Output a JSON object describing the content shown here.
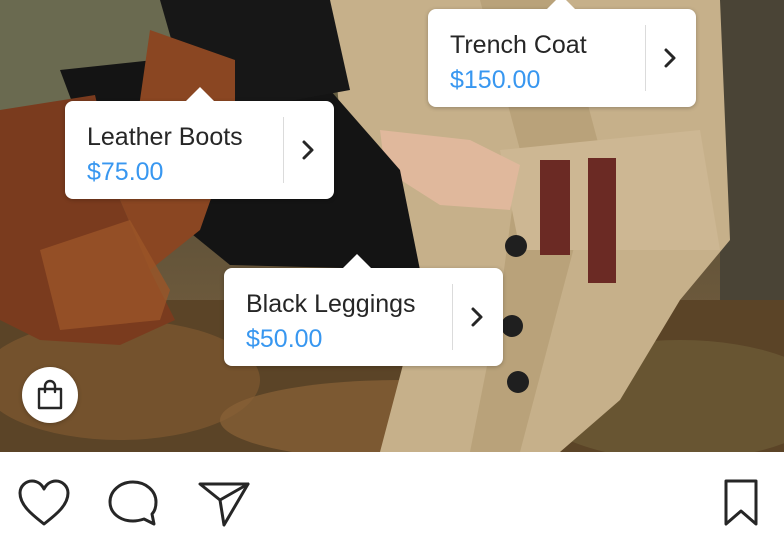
{
  "product_tags": [
    {
      "name": "Trench Coat",
      "price": "$150.00"
    },
    {
      "name": "Leather Boots",
      "price": "$75.00"
    },
    {
      "name": "Black Leggings",
      "price": "$50.00"
    }
  ],
  "icons": {
    "tag_chevron": "chevron-right-icon",
    "shop": "shopping-bag-icon",
    "like": "heart-icon",
    "comment": "comment-icon",
    "share": "paper-plane-icon",
    "save": "bookmark-icon"
  },
  "colors": {
    "price": "#3897f0",
    "product_name": "#262626",
    "icon_stroke": "#262626",
    "tag_background": "#ffffff"
  }
}
